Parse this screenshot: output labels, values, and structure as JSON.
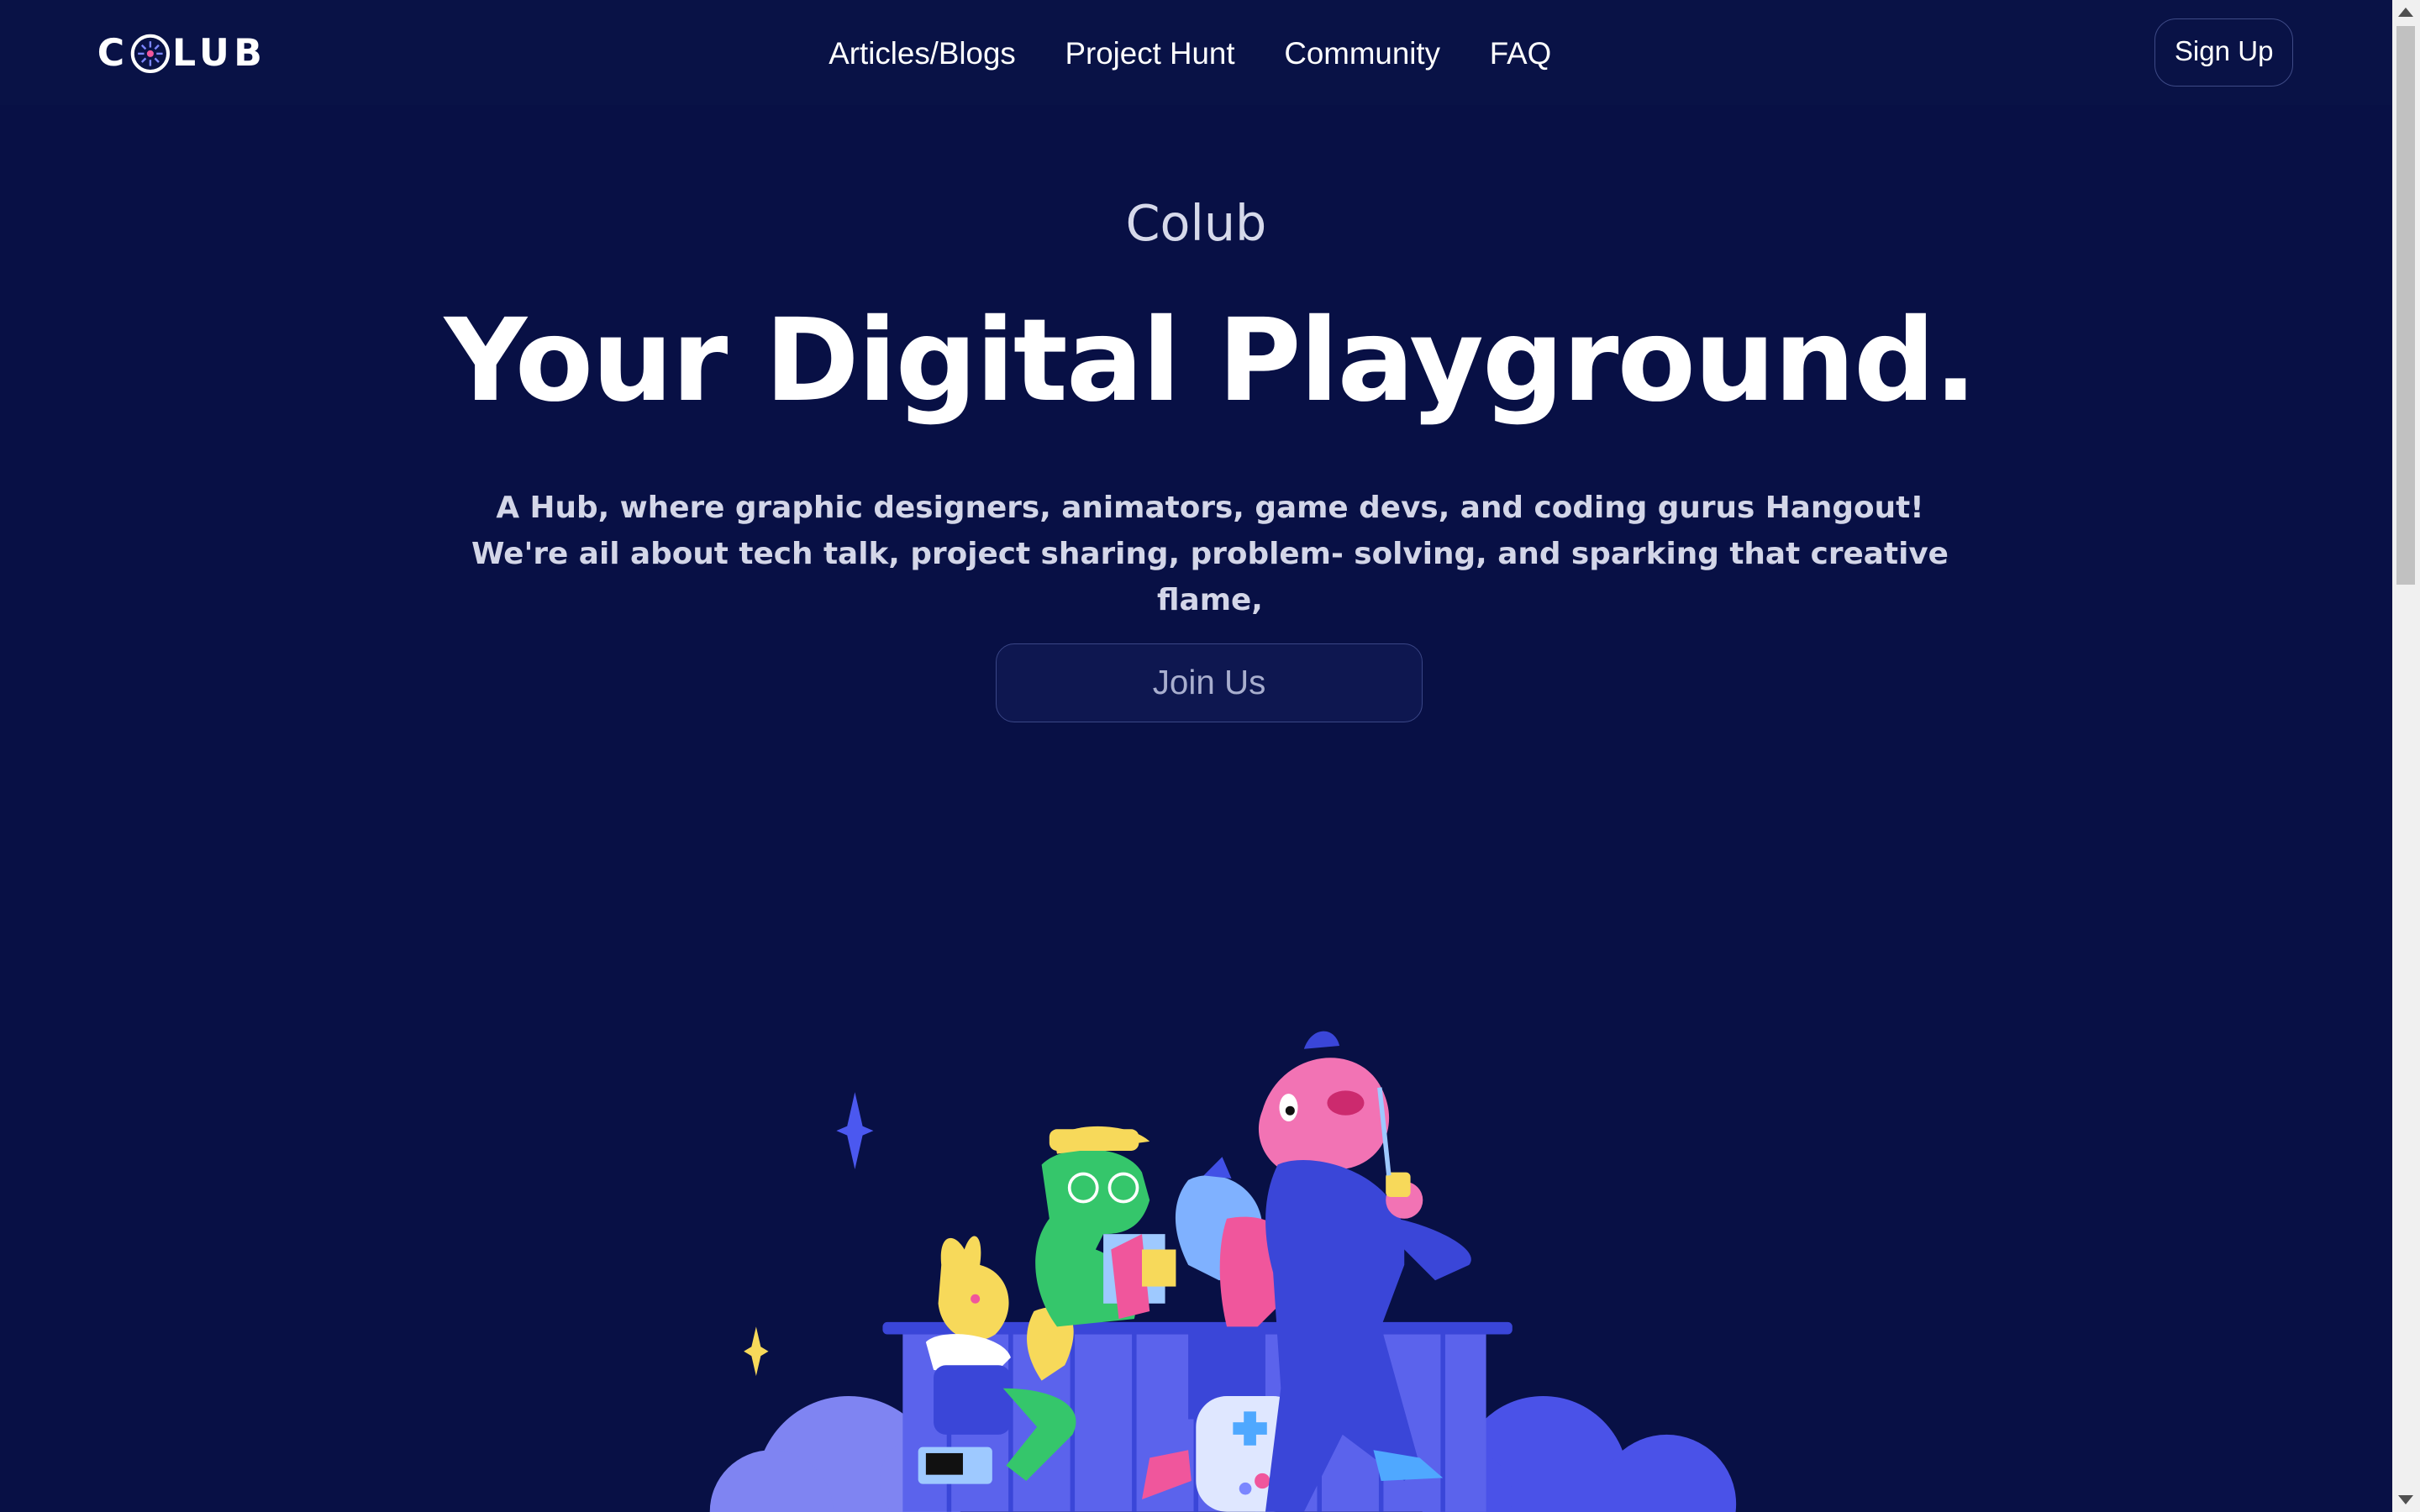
{
  "header": {
    "logo_left": "C",
    "logo_right": "LUB",
    "nav": [
      {
        "label": "Articles/Blogs"
      },
      {
        "label": "Project Hunt"
      },
      {
        "label": "Community"
      },
      {
        "label": "FAQ"
      }
    ],
    "signup_label": "Sign Up"
  },
  "hero": {
    "brand": "Colub",
    "headline": "Your Digital Playground.",
    "tagline": "A Hub, where graphic designers, animators, game devs, and coding gurus Hangout! We're ail about tech talk, project sharing, problem- solving, and sparking that creative flame,",
    "join_label": "Join Us"
  },
  "colors": {
    "background": "#081045",
    "accent_blue": "#4150e6",
    "pink": "#f0569c",
    "green": "#35c66b",
    "yellow": "#f7d95a"
  },
  "icons": {
    "logo_orb": "logo-orb-icon",
    "sparkle": "sparkle-icon"
  }
}
